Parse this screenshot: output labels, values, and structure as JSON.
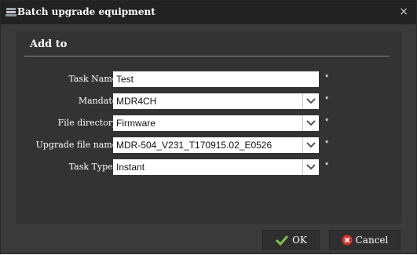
{
  "dialog": {
    "title": "Batch upgrade equipment",
    "close_label": "×"
  },
  "section": {
    "title": "Add to"
  },
  "form": {
    "task_name": {
      "label": "Task Name:",
      "value": "Test"
    },
    "mandate": {
      "label": "Mandate:",
      "value": "MDR4CH"
    },
    "file_directory": {
      "label": "File directory:",
      "value": "Firmware"
    },
    "upgrade_file": {
      "label": "Upgrade file name:",
      "value": "MDR-504_V231_T170915.02_E0526"
    },
    "task_types": {
      "label": "Task Types:",
      "value": "Instant"
    },
    "required_mark": "*"
  },
  "buttons": {
    "ok_label": "OK",
    "cancel_label": "Cancel"
  },
  "colors": {
    "ok_check": "#7dc242",
    "cancel_red": "#e0302a"
  }
}
